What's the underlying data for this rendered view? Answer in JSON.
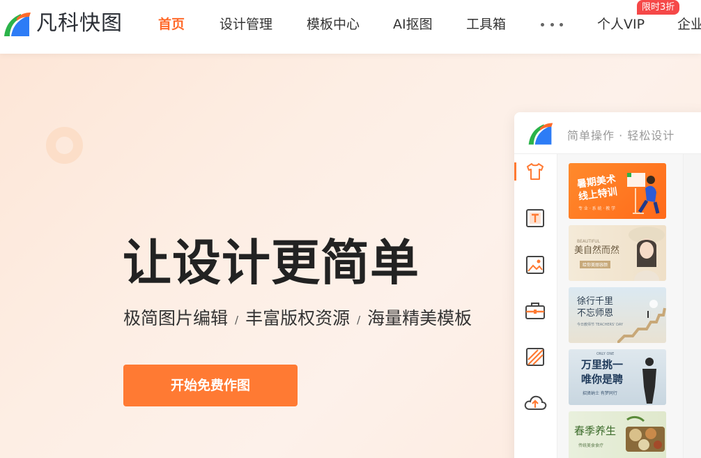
{
  "header": {
    "logo_text": "凡科快图",
    "nav": [
      {
        "label": "首页",
        "active": true
      },
      {
        "label": "设计管理",
        "active": false
      },
      {
        "label": "模板中心",
        "active": false
      },
      {
        "label": "AI抠图",
        "active": false
      },
      {
        "label": "工具箱",
        "active": false
      },
      {
        "label": "个人VIP",
        "active": false
      },
      {
        "label": "企业",
        "active": false
      }
    ],
    "more_icon": "more-dots-icon",
    "vip_badge": "限时3折"
  },
  "hero": {
    "title": "让设计更简单",
    "subtitle": {
      "items": [
        "极简图片编辑",
        "丰富版权资源",
        "海量精美模板"
      ],
      "separator": "/"
    },
    "cta_label": "开始免费作图"
  },
  "panel": {
    "slogan": "简单操作 · 轻松设计",
    "sidebar_icons": [
      "tshirt-icon",
      "text-icon",
      "image-icon",
      "toolbox-icon",
      "background-pattern-icon",
      "cloud-upload-icon"
    ],
    "templates": [
      {
        "title_line1": "暑期美术",
        "title_line2": "线上特训",
        "small": "专 业 · 系 统 · 教 学",
        "theme": "orange"
      },
      {
        "title_line1": "美自然而然",
        "title_line2": "",
        "small": "BEAUTIFUL",
        "small2": "给你美丽容颜",
        "theme": "cream"
      },
      {
        "title_line1": "徐行千里",
        "title_line2": "不忘师恩",
        "small": "今日教师节 TEACHERS' DAY",
        "theme": "sky"
      },
      {
        "title_line1": "万里挑一",
        "title_line2": "唯你是聘",
        "small": "ONLY ONE",
        "small2": "招贤纳士 有梦同行",
        "theme": "blue"
      },
      {
        "title_line1": "春季养生",
        "title_line2": "",
        "small": "传统美食食疗",
        "theme": "green"
      }
    ]
  },
  "colors": {
    "accent": "#ff7a33",
    "badge": "#f54848",
    "logo_orange": "#ff6a2a",
    "logo_green": "#2bb34a",
    "logo_blue": "#2d7cf6"
  }
}
